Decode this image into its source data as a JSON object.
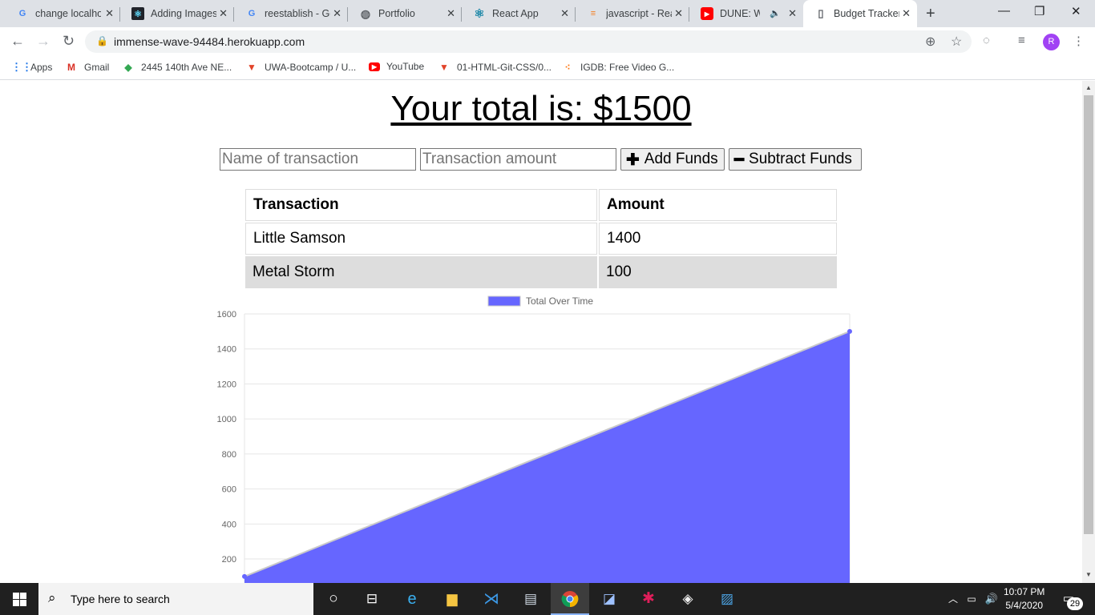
{
  "browser": {
    "tabs": [
      {
        "title": "change localhost",
        "favicon": "google-icon"
      },
      {
        "title": "Adding Images",
        "favicon": "react-icon"
      },
      {
        "title": "reestablish - Google",
        "favicon": "google-icon"
      },
      {
        "title": "Portfolio",
        "favicon": "globe-icon"
      },
      {
        "title": "React App",
        "favicon": "react-icon"
      },
      {
        "title": "javascript - React",
        "favicon": "stackoverflow-icon"
      },
      {
        "title": "DUNE: Wh",
        "favicon": "youtube-icon"
      },
      {
        "title": "Budget Tracker",
        "favicon": "document-icon",
        "active": true
      }
    ],
    "url": "immense-wave-94484.herokuapp.com",
    "profile_initial": "R",
    "bookmarks": [
      {
        "label": "Apps",
        "icon": "apps-grid-icon"
      },
      {
        "label": "Gmail",
        "icon": "gmail-icon"
      },
      {
        "label": "2445 140th Ave NE...",
        "icon": "maps-icon"
      },
      {
        "label": "UWA-Bootcamp / U...",
        "icon": "gitlab-icon"
      },
      {
        "label": "YouTube",
        "icon": "youtube-icon"
      },
      {
        "label": "01-HTML-Git-CSS/0...",
        "icon": "gitlab-icon"
      },
      {
        "label": "IGDB: Free Video G...",
        "icon": "igdb-icon"
      }
    ]
  },
  "page": {
    "total_label": "Your total is: $",
    "total_amount": "1500",
    "name_placeholder": "Name of transaction",
    "amount_placeholder": "Transaction amount",
    "add_label": "Add Funds",
    "subtract_label": "Subtract Funds",
    "table": {
      "headers": [
        "Transaction",
        "Amount"
      ],
      "rows": [
        {
          "name": "Little Samson",
          "amount": "1400"
        },
        {
          "name": "Metal Storm",
          "amount": "100"
        }
      ]
    }
  },
  "chart_data": {
    "type": "area",
    "series": [
      {
        "name": "Total Over Time",
        "values": [
          100,
          1500
        ],
        "color": "#6666ff"
      }
    ],
    "ylim": [
      0,
      1600
    ],
    "yticks": [
      200,
      400,
      600,
      800,
      1000,
      1200,
      1400,
      1600
    ],
    "legend": "top"
  },
  "taskbar": {
    "search_placeholder": "Type here to search",
    "time": "10:07 PM",
    "date": "5/4/2020",
    "notifications": "29"
  }
}
